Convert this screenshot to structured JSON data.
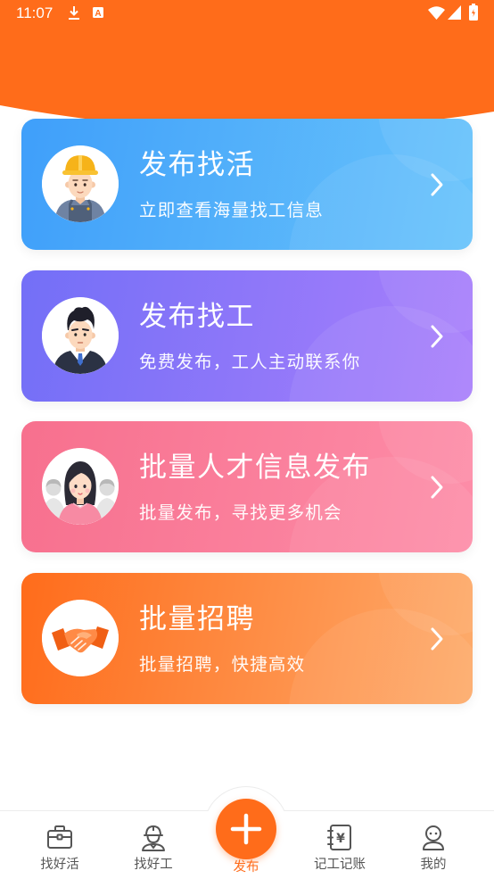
{
  "status_bar": {
    "time": "11:07",
    "notification_glyph": "A",
    "icons": [
      "download-icon",
      "notification-a-icon",
      "wifi-icon",
      "signal-icon",
      "battery-icon"
    ]
  },
  "colors": {
    "header": "#ff6c1a",
    "accent": "#ff6c1a",
    "nav_text": "#555555",
    "card_text": "#ffffff"
  },
  "cards": [
    {
      "title": "发布找活",
      "subtitle": "立即查看海量找工信息",
      "icon": "worker-avatar-icon",
      "gradient": [
        "#3f9ffa",
        "#68c3fb"
      ]
    },
    {
      "title": "发布找工",
      "subtitle": "免费发布，工人主动联系你",
      "icon": "businessman-avatar-icon",
      "gradient": [
        "#736ff7",
        "#a97ffb"
      ]
    },
    {
      "title": "批量人才信息发布",
      "subtitle": "批量发布，寻找更多机会",
      "icon": "talent-group-avatar-icon",
      "gradient": [
        "#f7708e",
        "#fd8da8"
      ]
    },
    {
      "title": "批量招聘",
      "subtitle": "批量招聘，快捷高效",
      "icon": "handshake-icon",
      "gradient": [
        "#ff6c1b",
        "#fdab6b"
      ]
    }
  ],
  "bottom_nav": {
    "items": [
      {
        "label": "找好活",
        "icon": "briefcase-icon"
      },
      {
        "label": "找好工",
        "icon": "worker-icon"
      },
      {
        "label": "发布",
        "icon": "plus-icon",
        "active": true
      },
      {
        "label": "记工记账",
        "icon": "ledger-icon",
        "symbol": "¥"
      },
      {
        "label": "我的",
        "icon": "profile-icon"
      }
    ]
  }
}
